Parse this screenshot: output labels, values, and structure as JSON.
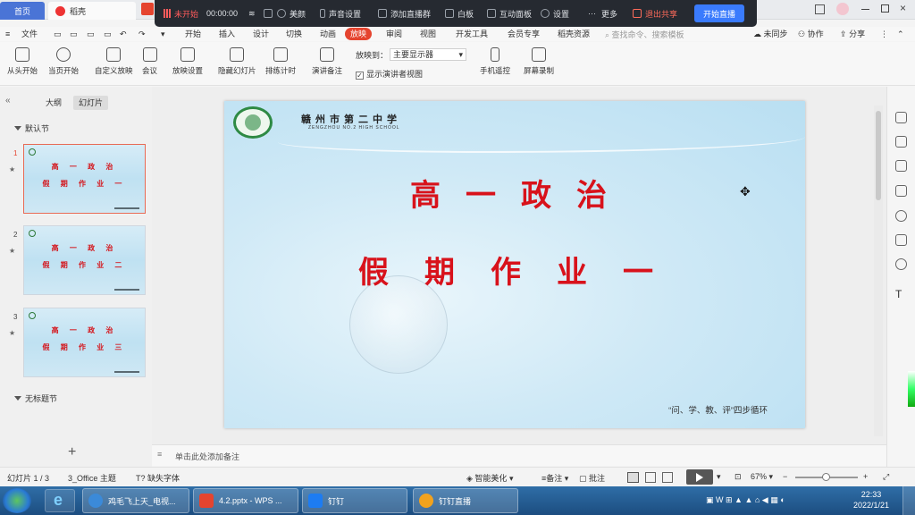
{
  "tabs": {
    "home": "首页",
    "daoke": "稻壳"
  },
  "meeting_bar": {
    "status": "未开始",
    "timer": "00:00:00",
    "beauty": "美颜",
    "audio_settings": "声音设置",
    "add_group": "添加直播群",
    "whiteboard": "白板",
    "interactive_panel": "互动面板",
    "settings": "设置",
    "more": "更多",
    "exit_share": "退出共享",
    "start_live": "开始直播"
  },
  "menu": {
    "file": "文件",
    "items": [
      "开始",
      "插入",
      "设计",
      "切换",
      "动画",
      "放映",
      "审阅",
      "视图",
      "开发工具",
      "会员专享",
      "稻壳资源"
    ],
    "active": "放映",
    "search_placeholder": "查找命令、搜索模板",
    "sync": "未同步",
    "collab": "协作",
    "share": "分享"
  },
  "ribbon": {
    "from_start": "从头开始",
    "from_current": "当页开始",
    "custom_show": "自定义放映",
    "meeting": "会议",
    "show_settings": "放映设置",
    "hide_slide": "隐藏幻灯片",
    "rehearse": "排练计时",
    "speaker_notes": "演讲备注",
    "display_to_label": "放映到：",
    "display_to_value": "主要显示器",
    "presenter_view": "显示演讲者视图",
    "phone_remote": "手机遥控",
    "screen_record": "屏幕录制"
  },
  "left_panel": {
    "tab_outline": "大纲",
    "tab_slides": "幻灯片",
    "section_default": "默认节",
    "section_untitled": "无标题节",
    "slides": [
      {
        "num": "1",
        "line1": "高 一 政 治",
        "line2": "假 期 作 业 一"
      },
      {
        "num": "2",
        "line1": "高 一 政 治",
        "line2": "假 期 作 业 二"
      },
      {
        "num": "3",
        "line1": "高 一 政 治",
        "line2": "假 期 作 业 三"
      }
    ],
    "add": "+"
  },
  "slide": {
    "school_cn": "赣州市第二中学",
    "school_en": "ZENGZHOU NO.2 HIGH SCHOOL",
    "title1": "高一政治",
    "title2": "假期作业一",
    "footer": "“问、学、教、评”四步循环"
  },
  "notes_placeholder": "单击此处添加备注",
  "status": {
    "slide_index": "幻灯片 1 / 3",
    "theme": "3_Office 主题",
    "missing_font": "缺失字体",
    "smart_beautify": "智能美化",
    "notes": "备注",
    "comments": "批注",
    "zoom": "67%"
  },
  "taskbar": {
    "apps": [
      "鸡毛飞上天_电视...",
      "4.2.pptx - WPS ...",
      "钉钉",
      "钉钉直播"
    ],
    "time": "22:33",
    "date": "2022/1/21"
  },
  "colors": {
    "accent": "#e5442f",
    "title_red": "#d8121b",
    "live_blue": "#3a7bfd"
  }
}
